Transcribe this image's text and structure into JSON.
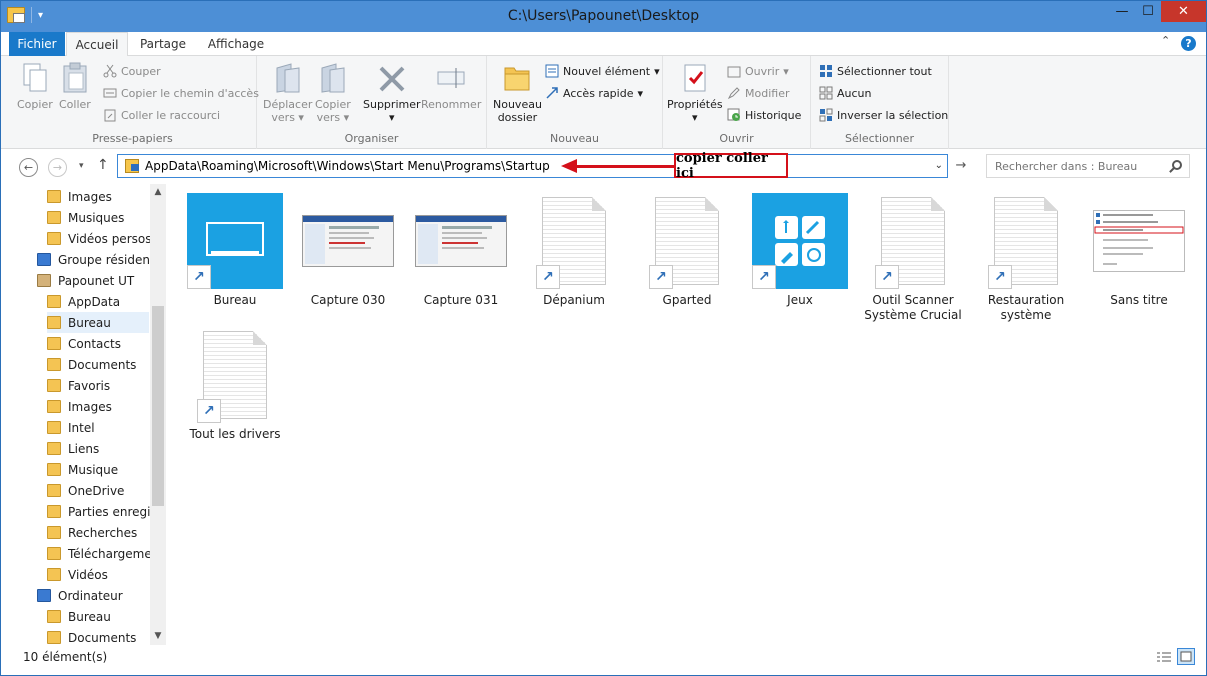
{
  "window": {
    "title": "C:\\Users\\Papounet\\Desktop"
  },
  "tabs": {
    "file": "Fichier",
    "home": "Accueil",
    "share": "Partage",
    "view": "Affichage"
  },
  "ribbon": {
    "clipboard": {
      "label": "Presse-papiers",
      "copy": "Copier",
      "paste": "Coller",
      "cut": "Couper",
      "copy_path": "Copier le chemin d'accès",
      "paste_shortcut": "Coller le raccourci"
    },
    "organize": {
      "label": "Organiser",
      "move_to": [
        "Déplacer",
        "vers"
      ],
      "copy_to": [
        "Copier",
        "vers"
      ],
      "delete": "Supprimer",
      "rename": "Renommer"
    },
    "new": {
      "label": "Nouveau",
      "new_folder": [
        "Nouveau",
        "dossier"
      ],
      "new_item": "Nouvel élément",
      "easy_access": "Accès rapide"
    },
    "open": {
      "label": "Ouvrir",
      "properties": "Propriétés",
      "open": "Ouvrir",
      "edit": "Modifier",
      "history": "Historique"
    },
    "select": {
      "label": "Sélectionner",
      "select_all": "Sélectionner tout",
      "select_none": "Aucun",
      "invert": "Inverser la sélection"
    }
  },
  "address": {
    "path": "AppData\\Roaming\\Microsoft\\Windows\\Start Menu\\Programs\\Startup"
  },
  "search": {
    "placeholder": "Rechercher dans : Bureau"
  },
  "annotation": {
    "text": "copier coller ici",
    "color": "#d4101a"
  },
  "nav_tree": [
    {
      "label": "Images",
      "indent": 2,
      "icon": "folder"
    },
    {
      "label": "Musiques",
      "indent": 2,
      "icon": "folder"
    },
    {
      "label": "Vidéos persos",
      "indent": 2,
      "icon": "folder"
    },
    {
      "label": "Groupe résidenti",
      "indent": 1,
      "icon": "homegroup"
    },
    {
      "label": "Papounet UT",
      "indent": 1,
      "icon": "user"
    },
    {
      "label": "AppData",
      "indent": 2,
      "icon": "folder"
    },
    {
      "label": "Bureau",
      "indent": 2,
      "icon": "folder",
      "selected": true
    },
    {
      "label": "Contacts",
      "indent": 2,
      "icon": "folder"
    },
    {
      "label": "Documents",
      "indent": 2,
      "icon": "folder"
    },
    {
      "label": "Favoris",
      "indent": 2,
      "icon": "star"
    },
    {
      "label": "Images",
      "indent": 2,
      "icon": "folder"
    },
    {
      "label": "Intel",
      "indent": 2,
      "icon": "folder"
    },
    {
      "label": "Liens",
      "indent": 2,
      "icon": "folder"
    },
    {
      "label": "Musique",
      "indent": 2,
      "icon": "folder"
    },
    {
      "label": "OneDrive",
      "indent": 2,
      "icon": "folder"
    },
    {
      "label": "Parties enregist",
      "indent": 2,
      "icon": "folder"
    },
    {
      "label": "Recherches",
      "indent": 2,
      "icon": "folder"
    },
    {
      "label": "Téléchargemer",
      "indent": 2,
      "icon": "folder"
    },
    {
      "label": "Vidéos",
      "indent": 2,
      "icon": "folder"
    },
    {
      "label": "Ordinateur",
      "indent": 1,
      "icon": "pc"
    },
    {
      "label": "Bureau",
      "indent": 2,
      "icon": "folder"
    },
    {
      "label": "Documents",
      "indent": 2,
      "icon": "folder"
    }
  ],
  "files": [
    {
      "name": "Bureau",
      "kind": "tile-desktop"
    },
    {
      "name": "Capture 030",
      "kind": "screenshot"
    },
    {
      "name": "Capture 031",
      "kind": "screenshot"
    },
    {
      "name": "Dépanium",
      "kind": "doc-shortcut"
    },
    {
      "name": "Gparted",
      "kind": "doc-shortcut"
    },
    {
      "name": "Jeux",
      "kind": "tile-games"
    },
    {
      "name": "Outil Scanner Système Crucial",
      "kind": "doc-shortcut"
    },
    {
      "name": "Restauration système",
      "kind": "doc-shortcut"
    },
    {
      "name": "Sans titre",
      "kind": "screenshot-menu"
    },
    {
      "name": "Tout les drivers",
      "kind": "doc-shortcut"
    }
  ],
  "status": {
    "count": "10 élément(s)"
  },
  "colors": {
    "accent": "#1979ca",
    "titlebar": "#4d8fd6",
    "tile": "#1ba1e2",
    "close": "#c7362b"
  }
}
